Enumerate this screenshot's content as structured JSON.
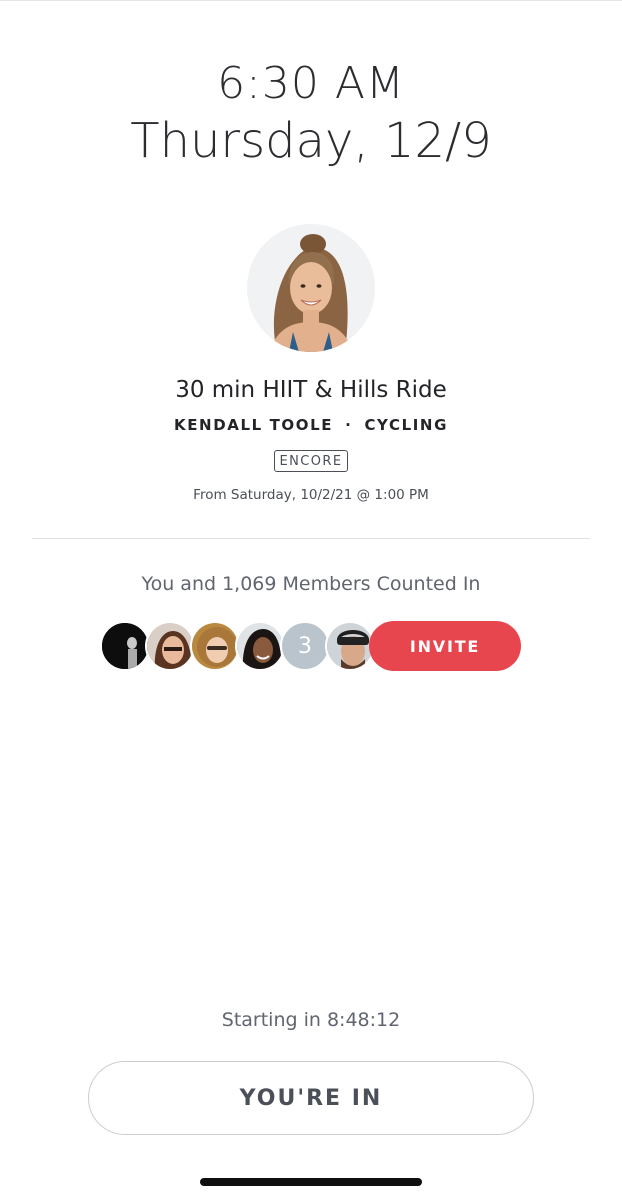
{
  "schedule": {
    "time": "6:30 AM",
    "date": "Thursday, 12/9"
  },
  "class": {
    "title": "30 min HIIT & Hills Ride",
    "instructor": "KENDALL TOOLE",
    "separator": "·",
    "discipline": "CYCLING",
    "badge": "ENCORE",
    "original_air": "From Saturday, 10/2/21 @ 1:00 PM"
  },
  "members": {
    "counted_text": "You and 1,069 Members Counted In",
    "more_count": "3",
    "invite_label": "INVITE"
  },
  "footer": {
    "starting_text": "Starting in 8:48:12",
    "status_button": "YOU'RE IN"
  },
  "colors": {
    "accent": "#e8464f",
    "text_dark": "#222428",
    "text_muted": "#61656f"
  }
}
